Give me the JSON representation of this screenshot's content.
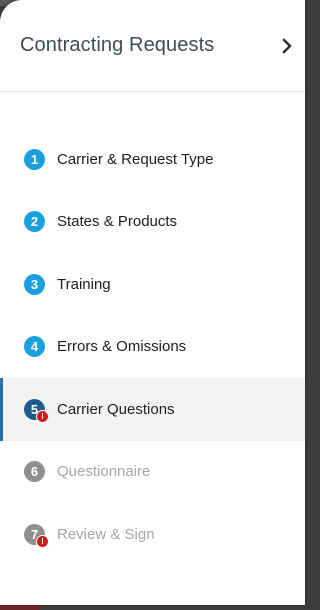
{
  "header": {
    "title": "Contracting Requests"
  },
  "steps": [
    {
      "number": "1",
      "label": "Carrier & Request Type",
      "state": "complete"
    },
    {
      "number": "2",
      "label": "States & Products",
      "state": "complete"
    },
    {
      "number": "3",
      "label": "Training",
      "state": "complete"
    },
    {
      "number": "4",
      "label": "Errors & Omissions",
      "state": "complete"
    },
    {
      "number": "5",
      "label": "Carrier Questions",
      "state": "active",
      "error": true
    },
    {
      "number": "6",
      "label": "Questionnaire",
      "state": "disabled"
    },
    {
      "number": "7",
      "label": "Review & Sign",
      "state": "disabled",
      "error": true
    }
  ],
  "colors": {
    "complete_badge": "#1a9fe0",
    "active_badge": "#1f5a8f",
    "disabled_badge": "#8f8f8f",
    "error_dot": "#d31a1a",
    "active_indicator": "#2a6fb0"
  },
  "icons": {
    "header": "chevron-right-icon",
    "error": "error-alert-icon"
  }
}
